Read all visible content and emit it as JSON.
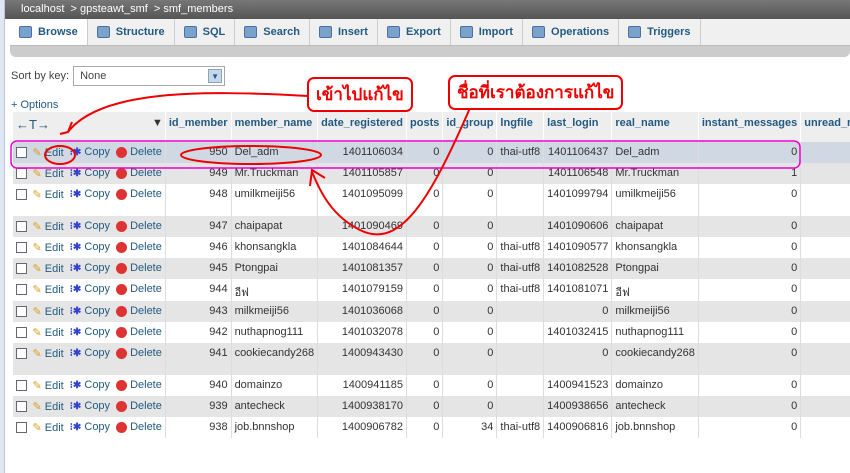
{
  "breadcrumb": [
    "localhost",
    "gpsteawt_smf",
    "smf_members"
  ],
  "tabs": [
    {
      "label": "Browse",
      "icon": "browse-icon"
    },
    {
      "label": "Structure",
      "icon": "structure-icon"
    },
    {
      "label": "SQL",
      "icon": "sql-icon"
    },
    {
      "label": "Search",
      "icon": "search-icon"
    },
    {
      "label": "Insert",
      "icon": "insert-icon"
    },
    {
      "label": "Export",
      "icon": "export-icon"
    },
    {
      "label": "Import",
      "icon": "import-icon"
    },
    {
      "label": "Operations",
      "icon": "wrench-icon"
    },
    {
      "label": "Triggers",
      "icon": "triggers-icon"
    }
  ],
  "sort": {
    "label": "Sort by key:",
    "value": "None"
  },
  "options_label": "+ Options",
  "arrows_label": "←T→",
  "actions": {
    "edit": "Edit",
    "copy": "Copy",
    "delete": "Delete"
  },
  "columns": [
    "id_member",
    "member_name",
    "date_registered",
    "posts",
    "id_group",
    "lngfile",
    "last_login",
    "real_name",
    "instant_messages",
    "unread_messa"
  ],
  "rows": [
    [
      "950",
      "Del_adm",
      "1401106034",
      "0",
      "0",
      "thai-utf8",
      "1401106437",
      "Del_adm",
      "0"
    ],
    [
      "949",
      "Mr.Truckman",
      "1401105857",
      "0",
      "0",
      "",
      "1401106548",
      "Mr.Truckman",
      "1"
    ],
    [
      "948",
      "umilkmeiji56",
      "1401095099",
      "0",
      "0",
      "",
      "1401099794",
      "umilkmeiji56",
      "0"
    ],
    [
      "947",
      "chaipapat",
      "1401090469",
      "0",
      "0",
      "",
      "1401090606",
      "chaipapat",
      "0"
    ],
    [
      "946",
      "khonsangkla",
      "1401084644",
      "0",
      "0",
      "thai-utf8",
      "1401090577",
      "khonsangkla",
      "0"
    ],
    [
      "945",
      "Ptongpai",
      "1401081357",
      "0",
      "0",
      "thai-utf8",
      "1401082528",
      "Ptongpai",
      "0"
    ],
    [
      "944",
      "อีฟ",
      "1401079159",
      "0",
      "0",
      "thai-utf8",
      "1401081071",
      "อีฟ",
      "0"
    ],
    [
      "943",
      "milkmeiji56",
      "1401036068",
      "0",
      "0",
      "",
      "0",
      "milkmeiji56",
      "0"
    ],
    [
      "942",
      "nuthapnog111",
      "1401032078",
      "0",
      "0",
      "",
      "1401032415",
      "nuthapnog111",
      "0"
    ],
    [
      "941",
      "cookiecandy268",
      "1400943430",
      "0",
      "0",
      "",
      "0",
      "cookiecandy268",
      "0"
    ],
    [
      "940",
      "domainzo",
      "1400941185",
      "0",
      "0",
      "",
      "1400941523",
      "domainzo",
      "0"
    ],
    [
      "939",
      "antecheck",
      "1400938170",
      "0",
      "0",
      "",
      "1400938656",
      "antecheck",
      "0"
    ],
    [
      "938",
      "job.bnnshop",
      "1400906782",
      "0",
      "34",
      "thai-utf8",
      "1400906816",
      "job.bnnshop",
      "0"
    ]
  ],
  "annotations": {
    "edit_note": "เข้าไปแก้ไข",
    "name_note": "ชื่อที่เราต้องการแก้ไข",
    "color": "#ee0000",
    "highlight_color": "#ee00cc"
  }
}
